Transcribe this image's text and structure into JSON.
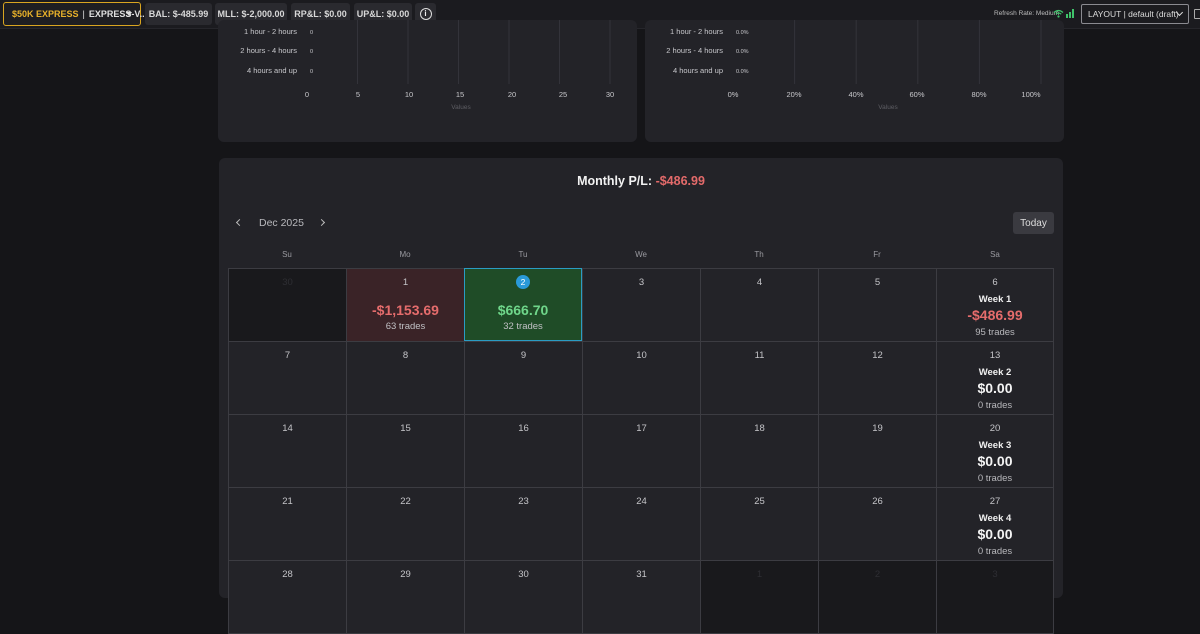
{
  "topbar": {
    "account_tier": "$50K EXPRESS",
    "account_sep": "|",
    "account_name": "EXPRESS-V...",
    "bal": "BAL: $-485.99",
    "mll": "MLL: $-2,000.00",
    "rpl": "RP&L: $0.00",
    "upl": "UP&L: $0.00",
    "info_glyph": "i",
    "refresh": "Refresh Rate: Medium",
    "layout": "LAYOUT | default (draft)"
  },
  "charts": [
    {
      "categories": [
        "1 hour - 2 hours",
        "2 hours - 4 hours",
        "4 hours and up"
      ],
      "values": [
        "0",
        "0",
        "0"
      ],
      "ticks": [
        "0",
        "5",
        "10",
        "15",
        "20",
        "25",
        "30"
      ],
      "xlabel": "Values"
    },
    {
      "categories": [
        "1 hour - 2 hours",
        "2 hours - 4 hours",
        "4 hours and up"
      ],
      "values": [
        "0.0%",
        "0.0%",
        "0.0%"
      ],
      "ticks": [
        "0%",
        "20%",
        "40%",
        "60%",
        "80%",
        "100%"
      ],
      "xlabel": "Values"
    }
  ],
  "chart_data": [
    {
      "type": "bar",
      "categories": [
        "1 hour - 2 hours",
        "2 hours - 4 hours",
        "4 hours and up"
      ],
      "values": [
        0,
        0,
        0
      ],
      "xlabel": "Values",
      "xlim": [
        0,
        30
      ]
    },
    {
      "type": "bar",
      "categories": [
        "1 hour - 2 hours",
        "2 hours - 4 hours",
        "4 hours and up"
      ],
      "values": [
        0,
        0,
        0
      ],
      "xlabel": "Values",
      "xlim": [
        0,
        100
      ]
    }
  ],
  "calendar": {
    "title_label": "Monthly P/L:",
    "title_value": "-$486.99",
    "month": "Dec 2025",
    "today": "Today",
    "weekdays": [
      "Su",
      "Mo",
      "Tu",
      "We",
      "Th",
      "Fr",
      "Sa"
    ],
    "days": {
      "r0": [
        "30",
        "1",
        "2",
        "3",
        "4",
        "5",
        "6"
      ],
      "r1": [
        "7",
        "8",
        "9",
        "10",
        "11",
        "12",
        "13"
      ],
      "r2": [
        "14",
        "15",
        "16",
        "17",
        "18",
        "19",
        "20"
      ],
      "r3": [
        "21",
        "22",
        "23",
        "24",
        "25",
        "26",
        "27"
      ],
      "r4": [
        "28",
        "29",
        "30",
        "31",
        "1",
        "2",
        "3"
      ]
    },
    "mon1": {
      "pnl": "-$1,153.69",
      "trades": "63 trades"
    },
    "tue2": {
      "pnl": "$666.70",
      "trades": "32 trades"
    },
    "weeks": [
      {
        "label": "Week 1",
        "value": "-$486.99",
        "trades": "95 trades"
      },
      {
        "label": "Week 2",
        "value": "$0.00",
        "trades": "0 trades"
      },
      {
        "label": "Week 3",
        "value": "$0.00",
        "trades": "0 trades"
      },
      {
        "label": "Week 4",
        "value": "$0.00",
        "trades": "0 trades"
      }
    ],
    "colors": {
      "loss": "#e56c6c",
      "profit": "#6fd68a",
      "today_ring": "#2a9ad8",
      "accent": "#e8b12a"
    }
  }
}
